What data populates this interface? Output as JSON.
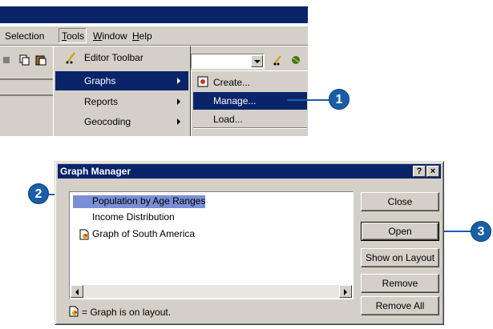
{
  "menubar": {
    "items": [
      "Selection",
      "Tools",
      "Window",
      "Help"
    ],
    "active": "Tools"
  },
  "tools_menu": {
    "items": [
      {
        "label": "Editor Toolbar",
        "submenu": false,
        "highlighted": false
      },
      {
        "label": "Graphs",
        "submenu": true,
        "highlighted": true
      },
      {
        "label": "Reports",
        "submenu": true,
        "highlighted": false
      },
      {
        "label": "Geocoding",
        "submenu": true,
        "highlighted": false
      }
    ]
  },
  "graphs_submenu": {
    "items": [
      {
        "label": "Create...",
        "highlighted": false
      },
      {
        "label": "Manage...",
        "highlighted": true
      },
      {
        "label": "Load...",
        "highlighted": false
      }
    ]
  },
  "callouts": [
    "1",
    "2",
    "3"
  ],
  "dialog": {
    "title": "Graph Manager",
    "help_btn": "?",
    "close_btn": "×",
    "list_items": [
      {
        "label": "Population by Age Ranges",
        "selected": true,
        "on_layout": false
      },
      {
        "label": "Income Distribution",
        "selected": false,
        "on_layout": false
      },
      {
        "label": "Graph of South America",
        "selected": false,
        "on_layout": true
      }
    ],
    "buttons": [
      "Close",
      "Open",
      "Show on Layout",
      "Remove",
      "Remove All"
    ],
    "legend": "= Graph is on layout."
  },
  "colors": {
    "highlight": "#0a246a",
    "selection": "#7b8fd6",
    "callout": "#1a5ea8",
    "face": "#d4d0c8"
  }
}
